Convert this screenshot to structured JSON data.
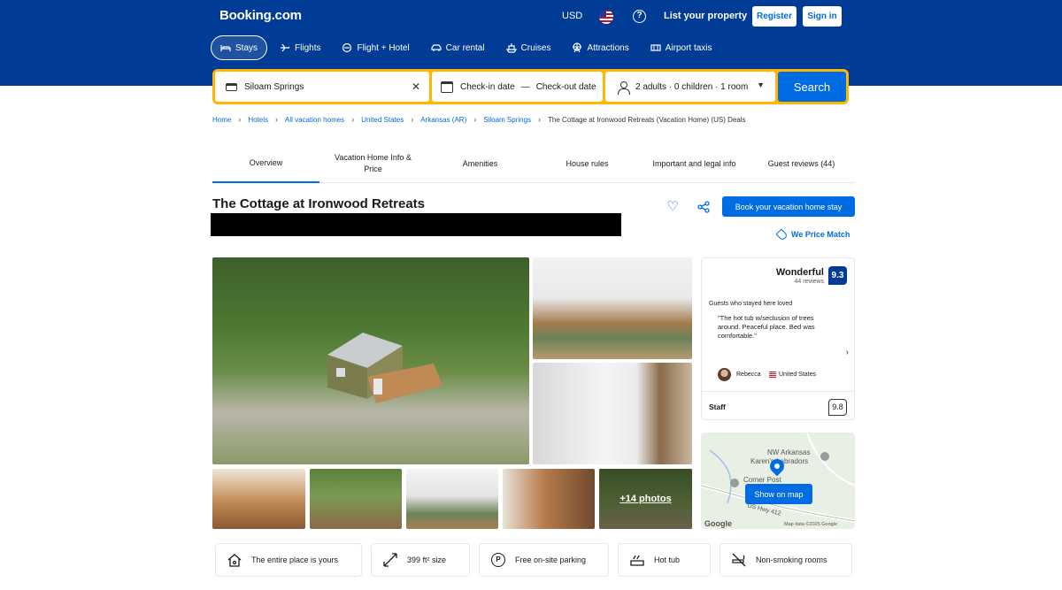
{
  "header": {
    "logo": "Booking.com",
    "currency": "USD",
    "list_property": "List your property",
    "register": "Register",
    "sign_in": "Sign in",
    "help": "?",
    "nav": [
      {
        "label": "Stays",
        "icon": "bed-icon"
      },
      {
        "label": "Flights",
        "icon": "plane-icon"
      },
      {
        "label": "Flight + Hotel",
        "icon": "flight-hotel-icon"
      },
      {
        "label": "Car rental",
        "icon": "car-icon"
      },
      {
        "label": "Cruises",
        "icon": "ship-icon"
      },
      {
        "label": "Attractions",
        "icon": "ferris-wheel-icon"
      },
      {
        "label": "Airport taxis",
        "icon": "taxi-icon"
      }
    ]
  },
  "search": {
    "destination": "Siloam Springs",
    "checkin": "Check-in date",
    "dash": "—",
    "checkout": "Check-out date",
    "guests": "2 adults · 0 children · 1 room",
    "button": "Search"
  },
  "breadcrumb": [
    "Home",
    "Hotels",
    "All vacation homes",
    "United States",
    "Arkansas (AR)",
    "Siloam Springs",
    "The Cottage at Ironwood Retreats (Vacation Home) (US) Deals"
  ],
  "tabs": [
    "Overview",
    "Vacation Home Info & Price",
    "Amenities",
    "House rules",
    "Important and legal info",
    "Guest reviews (44)"
  ],
  "property": {
    "title": "The Cottage at Ironwood Retreats",
    "book_button": "Book your vacation home stay",
    "price_match": "We Price Match"
  },
  "photos": {
    "more": "+14 photos"
  },
  "review": {
    "label": "Wonderful",
    "count": "44 reviews",
    "score": "9.3",
    "loved": "Guests who stayed here loved",
    "quote": "\"The hot tub w/seclusion of trees around. Peaceful place. Bed was comfortable.\"",
    "reviewer": "Rebecca",
    "country": "United States",
    "staff_label": "Staff",
    "staff_score": "9.8"
  },
  "map": {
    "label1": "NW Arkansas",
    "label2": "Karen's Labradors",
    "label3": "Corner Post",
    "label4": "US Hwy 412",
    "button": "Show on map",
    "google": "Google",
    "data": "Map data ©2025 Google"
  },
  "amenities": [
    {
      "label": "The entire place is yours",
      "icon": "house-key-icon"
    },
    {
      "label": "399 ft² size",
      "icon": "size-icon"
    },
    {
      "label": "Free on-site parking",
      "icon": "parking-icon"
    },
    {
      "label": "Hot tub",
      "icon": "hot-tub-icon"
    },
    {
      "label": "Non-smoking rooms",
      "icon": "no-smoking-icon"
    }
  ],
  "colors": {
    "brand": "#003b95",
    "accent": "#006ce4",
    "search_border": "#ffb700"
  }
}
